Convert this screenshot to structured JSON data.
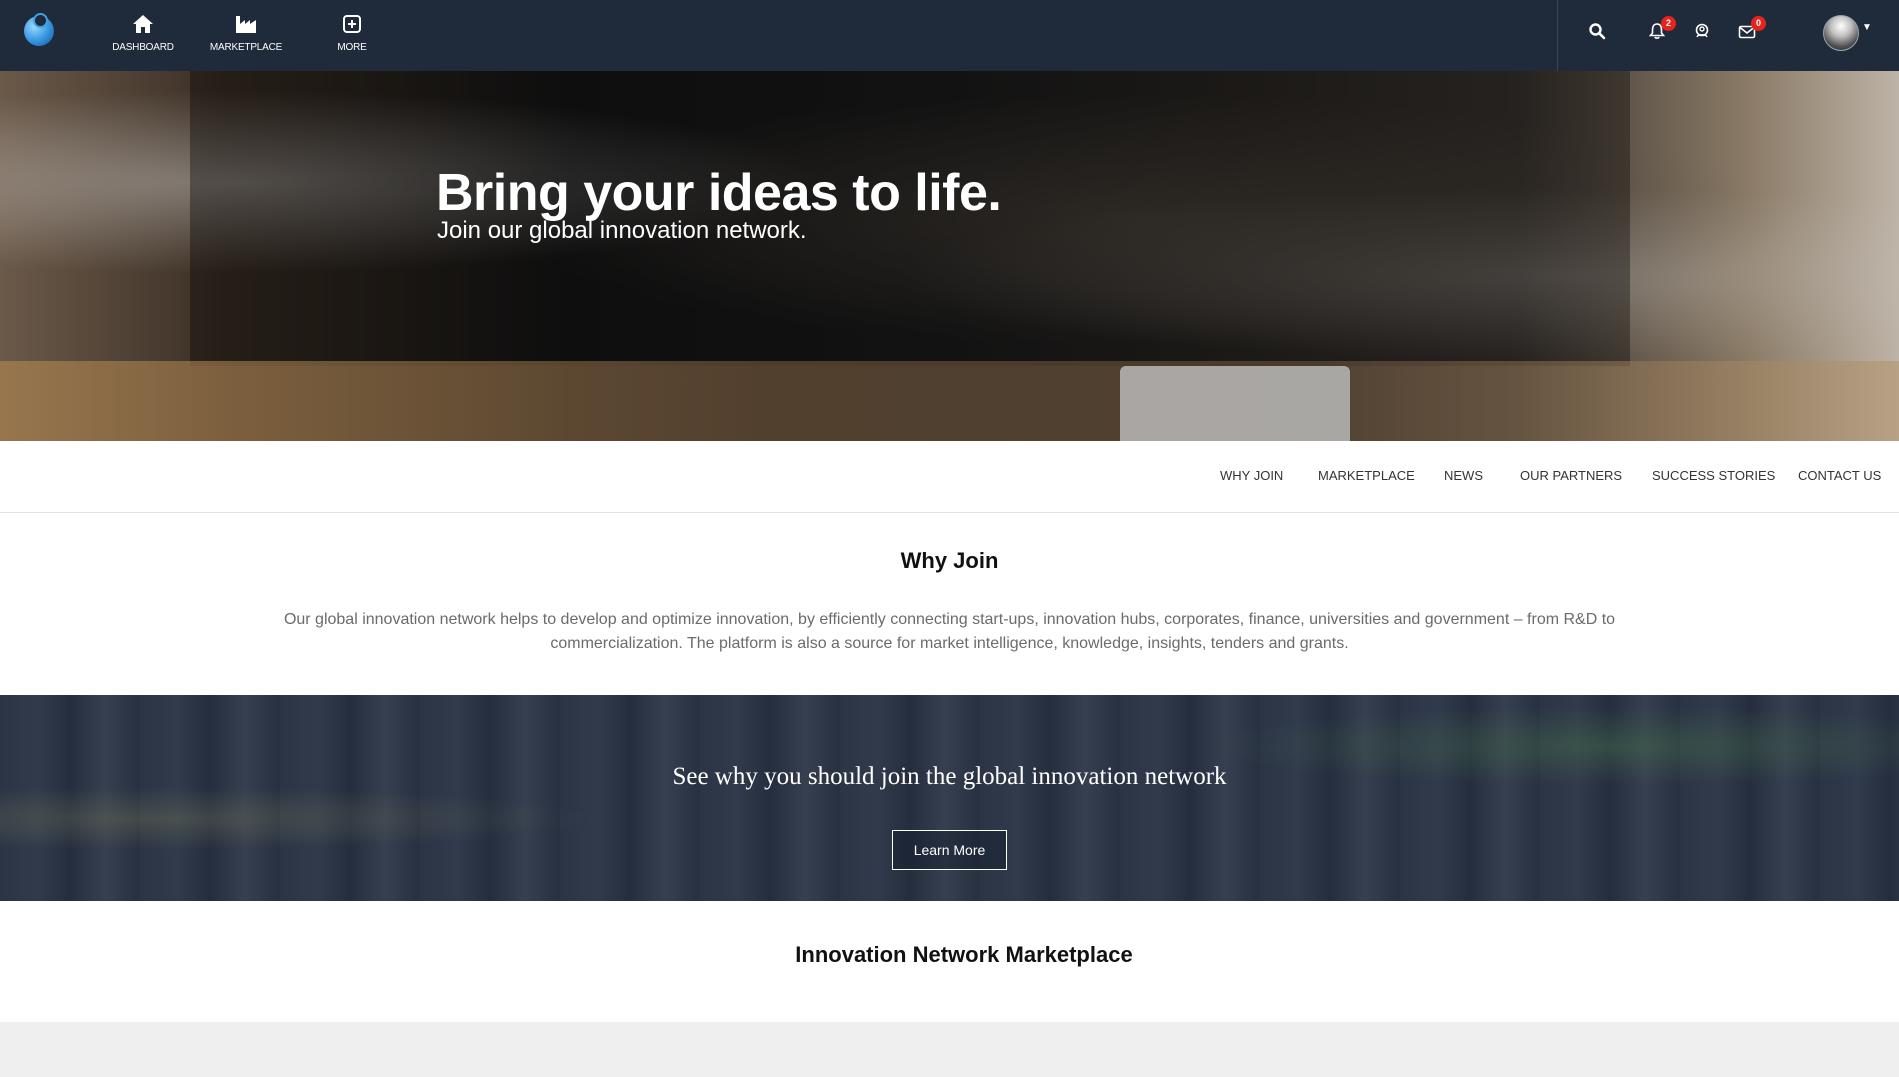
{
  "topbar": {
    "nav": [
      {
        "label": "DASHBOARD",
        "icon": "home-icon"
      },
      {
        "label": "MARKETPLACE",
        "icon": "factory-icon"
      },
      {
        "label": "MORE",
        "icon": "plus-square-icon"
      }
    ],
    "icons": {
      "search": "search-icon",
      "notifications": "bell-icon",
      "notifications_count": "2",
      "contacts": "contacts-icon",
      "messages": "envelope-icon",
      "messages_count": "0"
    },
    "colors": {
      "background": "#1f2a3a",
      "badge": "#e8231c"
    }
  },
  "hero": {
    "title": "Bring your ideas to life.",
    "subtitle": "Join our global innovation network."
  },
  "section_nav": {
    "items": [
      "WHY JOIN",
      "MARKETPLACE",
      "NEWS",
      "OUR PARTNERS",
      "SUCCESS STORIES",
      "CONTACT US"
    ]
  },
  "why_join": {
    "title": "Why Join",
    "text": "Our global innovation network helps to develop and optimize innovation, by efficiently connecting start-ups, innovation hubs, corporates, finance, universities and government – from R&D to commercialization. The platform is also a source for market intelligence, knowledge, insights, tenders and grants."
  },
  "banner": {
    "title": "See why you should join the global innovation network",
    "button_label": "Learn More"
  },
  "marketplace": {
    "title": "Innovation Network Marketplace"
  }
}
